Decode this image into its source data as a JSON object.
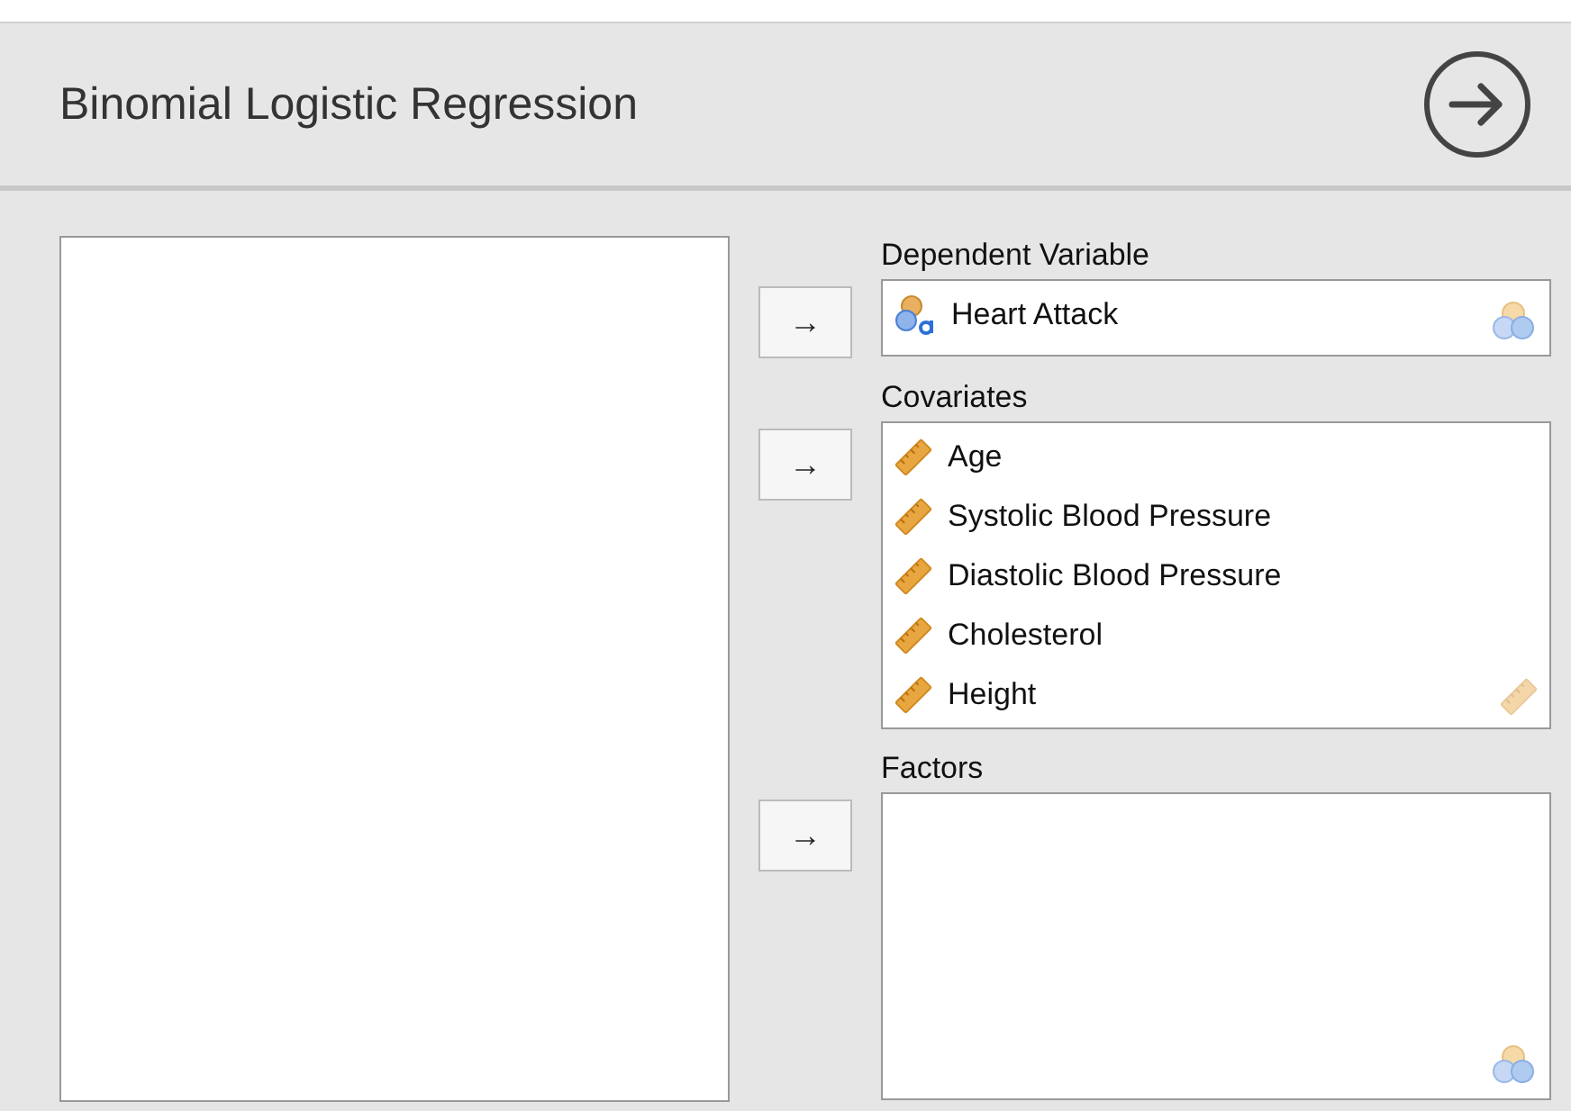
{
  "title": "Binomial Logistic Regression",
  "sections": [
    {
      "label": "Dependent Variable",
      "button": "→",
      "kind": "nominal",
      "items": [
        {
          "name": "Heart Attack",
          "kind": "nominal"
        }
      ]
    },
    {
      "label": "Covariates",
      "button": "→",
      "kind": "scale",
      "items": [
        {
          "name": "Age",
          "kind": "scale"
        },
        {
          "name": "Systolic Blood Pressure",
          "kind": "scale"
        },
        {
          "name": "Diastolic Blood Pressure",
          "kind": "scale"
        },
        {
          "name": "Cholesterol",
          "kind": "scale"
        },
        {
          "name": "Height",
          "kind": "scale"
        }
      ]
    },
    {
      "label": "Factors",
      "button": "→",
      "kind": "nominal"
    }
  ]
}
